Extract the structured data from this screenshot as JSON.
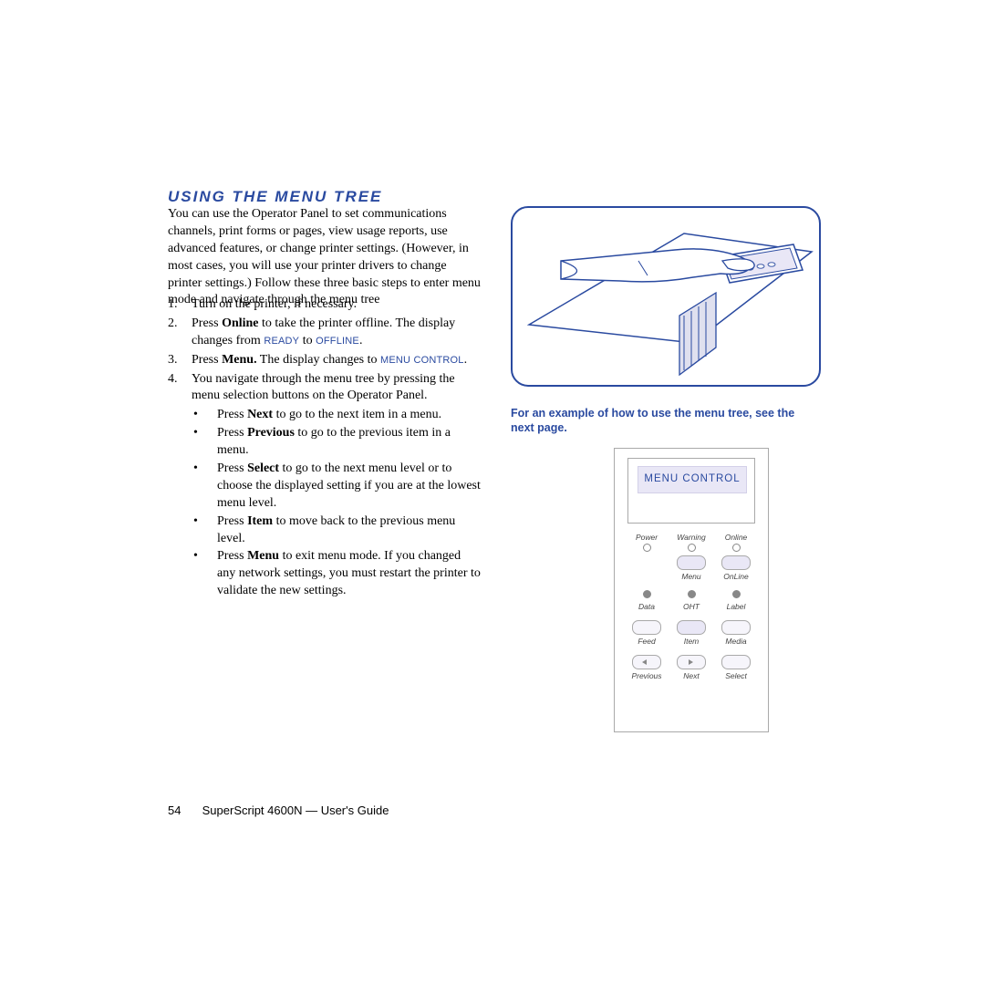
{
  "heading": "USING THE MENU TREE",
  "intro": "You can use the Operator Panel to set communications channels, print forms or pages, view usage reports, use advanced features, or change printer settings. (However, in most cases, you will use your printer drivers to change printer settings.) Follow these three basic steps to enter menu mode and navigate through the menu tree",
  "steps": {
    "s1": "Turn on the printer, if necessary.",
    "s2a": "Press ",
    "s2b": "Online",
    "s2c": " to take the printer offline. The display changes from ",
    "s2d": "READY",
    "s2e": " to ",
    "s2f": "OFFLINE",
    "s2g": ".",
    "s3a": "Press ",
    "s3b": "Menu.",
    "s3c": " The display changes to ",
    "s3d": "MENU CONTROL",
    "s3e": ".",
    "s4": "You navigate through the menu tree by pressing the menu selection buttons on the Operator Panel."
  },
  "bullets": {
    "b1a": "Press ",
    "b1b": "Next",
    "b1c": " to go to the next item in a menu.",
    "b2a": "Press ",
    "b2b": "Previous",
    "b2c": " to go to the previous item in a menu.",
    "b3a": "Press ",
    "b3b": "Select",
    "b3c": " to go to the next menu level or to choose the displayed setting if you are at the lowest menu level.",
    "b4a": "Press ",
    "b4b": "Item",
    "b4c": " to move back to the previous menu level.",
    "b5a": "Press ",
    "b5b": "Menu",
    "b5c": " to exit menu mode. If you changed any network settings, you must restart the printer to validate the new settings."
  },
  "figure_note": "For an example of how to use the menu tree, see the next page.",
  "panel": {
    "display": "MENU CONTROL",
    "leds": {
      "power": "Power",
      "warning": "Warning",
      "online": "Online"
    },
    "row1": {
      "menu": "Menu",
      "online": "OnLine"
    },
    "leds2": {
      "data": "Data",
      "oht": "OHT",
      "label": "Label"
    },
    "row2": {
      "feed": "Feed",
      "item": "Item",
      "media": "Media"
    },
    "row3": {
      "previous": "Previous",
      "next": "Next",
      "select": "Select"
    }
  },
  "footer": {
    "page": "54",
    "title": "SuperScript 4600N — User's Guide"
  }
}
